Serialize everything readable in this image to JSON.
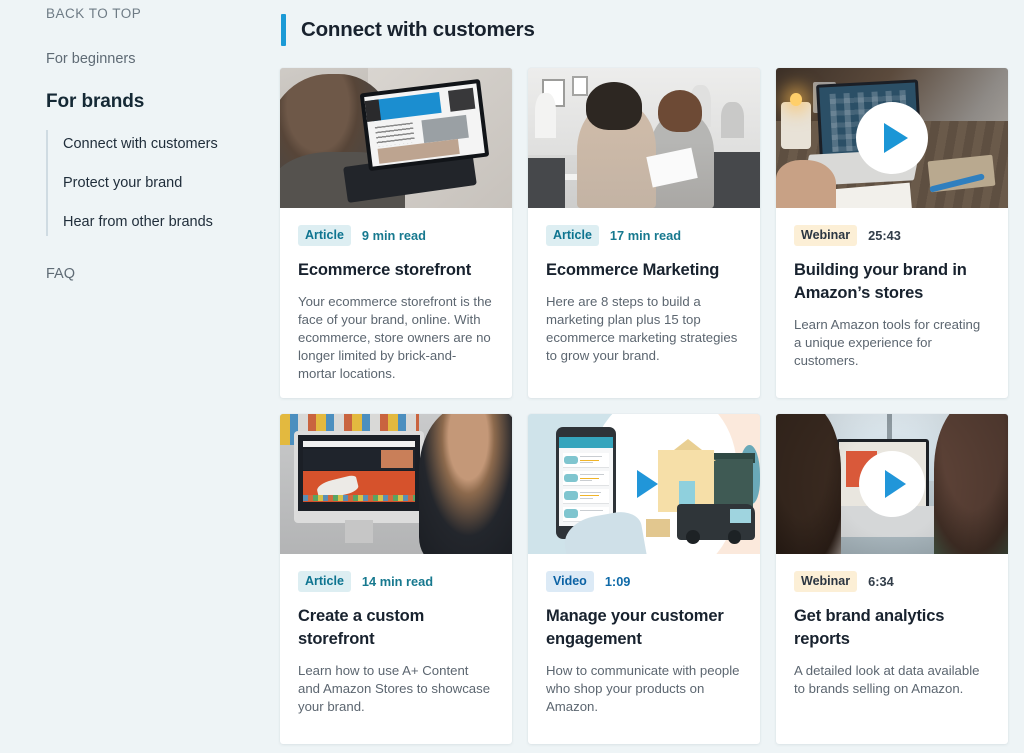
{
  "sidebar": {
    "back_to_top": "BACK TO TOP",
    "for_beginners": "For beginners",
    "for_brands": "For brands",
    "sub_items": [
      {
        "label": "Connect with customers"
      },
      {
        "label": "Protect your brand"
      },
      {
        "label": "Hear from other brands"
      }
    ],
    "faq": "FAQ"
  },
  "header": {
    "title": "Connect with customers",
    "accent_color": "#1b9ad6"
  },
  "cards": [
    {
      "badge": "Article",
      "badge_type": "article",
      "duration": "9 min read",
      "title": "Ecommerce storefront",
      "description": "Your ecommerce storefront is the face of your brand, online. With ecommerce, store owners are no longer limited by brick-and-mortar locations.",
      "media": "woman-laptop-couch-photo",
      "has_play": false
    },
    {
      "badge": "Article",
      "badge_type": "article",
      "duration": "17 min read",
      "title": "Ecommerce Marketing",
      "description": "Here are 8 steps to build a marketing plan plus 15 top ecommerce marketing strategies to grow your brand.",
      "media": "two-women-office-photo",
      "has_play": false
    },
    {
      "badge": "Webinar",
      "badge_type": "webinar",
      "duration": "25:43",
      "title": "Building your brand in Amazon’s stores",
      "description": "Learn Amazon tools for creating a unique experience for customers.",
      "media": "desk-workspace-laptop-photo",
      "has_play": true
    },
    {
      "badge": "Article",
      "badge_type": "article",
      "duration": "14 min read",
      "title": "Create a custom storefront",
      "description": "Learn how to use A+ Content and Amazon Stores to showcase your brand.",
      "media": "man-imac-storefront-photo",
      "has_play": false
    },
    {
      "badge": "Video",
      "badge_type": "video",
      "duration": "1:09",
      "title": "Manage your customer engagement",
      "description": "How to communicate with people who shop your products on Amazon.",
      "media": "phone-house-delivery-illustration",
      "has_play": true
    },
    {
      "badge": "Webinar",
      "badge_type": "webinar",
      "duration": "6:34",
      "title": "Get brand analytics reports",
      "description": "A detailed look at data available to brands selling on Amazon.",
      "media": "two-women-laptop-photo",
      "has_play": true
    }
  ],
  "colors": {
    "page_background": "#eef4f6",
    "card_background": "#ffffff",
    "accent_blue": "#1b9ad6",
    "badge_article_bg": "#ddeef2",
    "badge_article_text": "#0d7490",
    "badge_video_bg": "#dceaf6",
    "badge_video_text": "#0b62a4",
    "badge_webinar_bg": "#fcefd6",
    "badge_webinar_text": "#2b3642",
    "title_text": "#18222e",
    "body_text": "#5c6670"
  }
}
